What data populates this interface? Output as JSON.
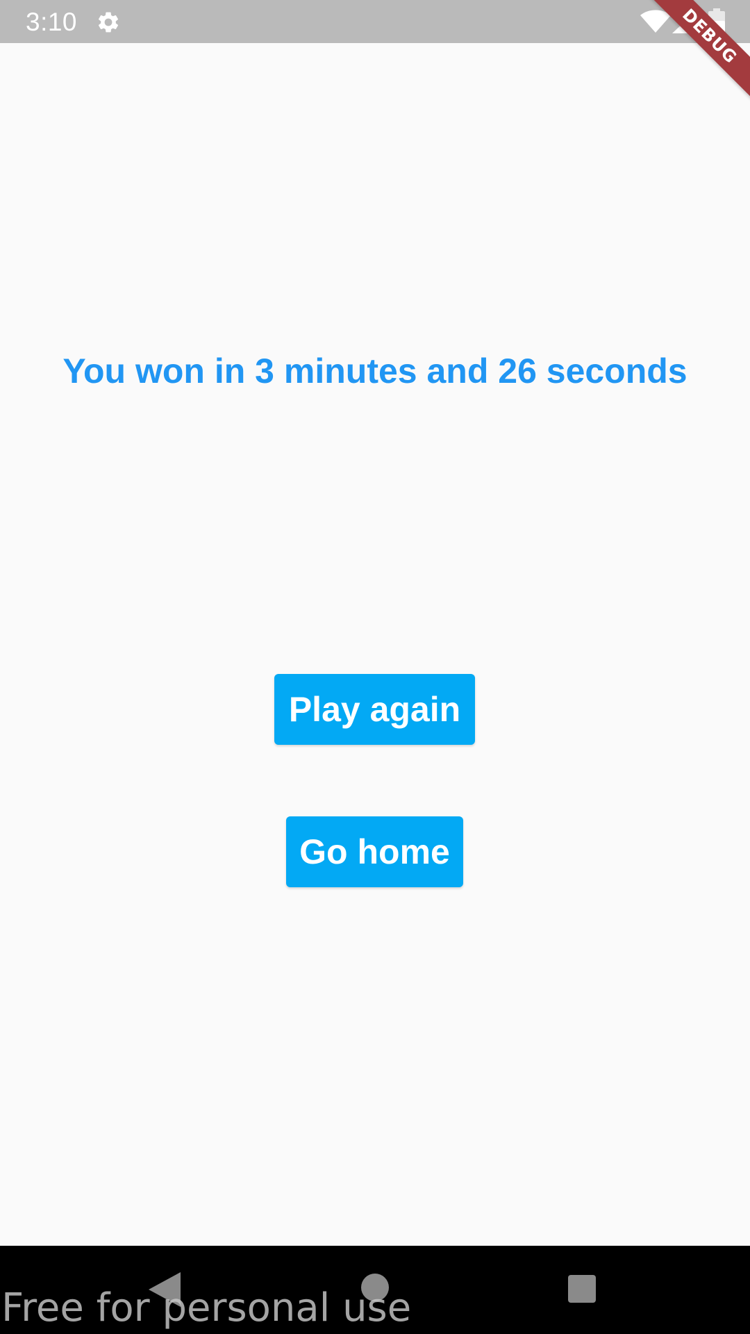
{
  "status_bar": {
    "time": "3:10",
    "icons": [
      "gear-icon",
      "wifi-icon",
      "signal-icon",
      "battery-icon"
    ]
  },
  "debug_banner": {
    "label": "DEBUG",
    "color": "#a33b3e"
  },
  "main": {
    "win_message": "You won in 3 minutes and 26 seconds",
    "message_color": "#2196f3",
    "play_again_label": "Play again",
    "go_home_label": "Go home",
    "button_color": "#03a9f4"
  },
  "nav_bar": {
    "icons": [
      "back-icon",
      "home-icon",
      "recents-icon"
    ]
  },
  "watermark": {
    "text": "Free for personal use"
  }
}
